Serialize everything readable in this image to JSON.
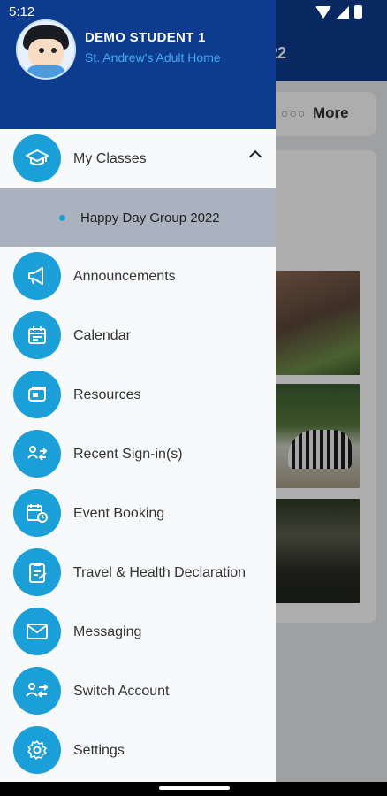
{
  "status_bar": {
    "time": "5:12"
  },
  "background": {
    "header_title": "22",
    "more_label": "More"
  },
  "drawer": {
    "user": {
      "name": "DEMO STUDENT 1",
      "organization": "St. Andrew's Adult Home"
    },
    "menu": {
      "my_classes": "My Classes",
      "classes": [
        "Happy Day Group 2022"
      ],
      "announcements": "Announcements",
      "calendar": "Calendar",
      "resources": "Resources",
      "recent_signins": "Recent Sign-in(s)",
      "event_booking": "Event Booking",
      "travel_health": "Travel & Health Declaration",
      "messaging": "Messaging",
      "switch_account": "Switch Account",
      "settings": "Settings"
    }
  },
  "colors": {
    "header_blue": "#0d3c8f",
    "accent_blue": "#1a9fd8",
    "org_text": "#3fa9f5",
    "selected_row": "#a9b2be"
  }
}
